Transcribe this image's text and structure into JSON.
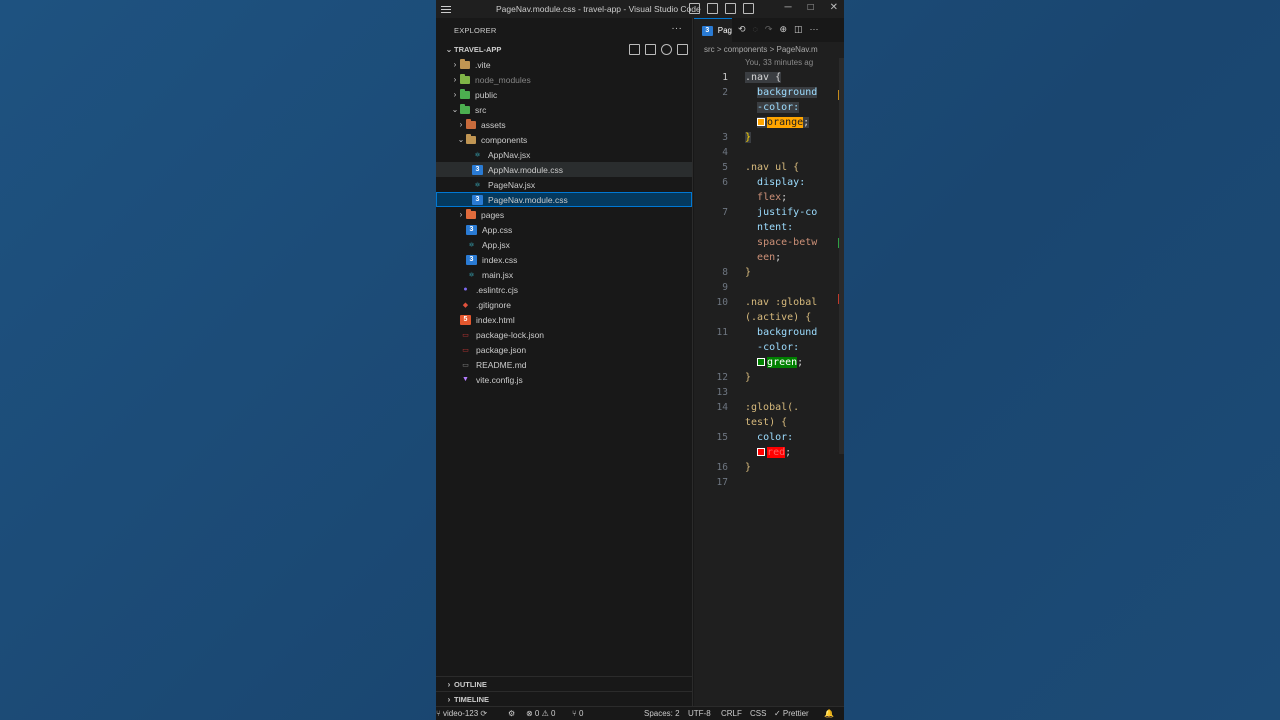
{
  "window": {
    "title": "PageNav.module.css - travel-app - Visual Studio Code",
    "controls": {
      "minimize": "─",
      "maximize": "□",
      "close": "✕"
    }
  },
  "explorer": {
    "header": "EXPLORER",
    "more": "···",
    "root": "TRAVEL-APP",
    "tree": [
      {
        "name": ".vite",
        "type": "folder",
        "depth": 1,
        "expanded": false,
        "color": "#c09553",
        "dim": false
      },
      {
        "name": "node_modules",
        "type": "folder",
        "depth": 1,
        "expanded": false,
        "color": "#7fb447",
        "dim": true
      },
      {
        "name": "public",
        "type": "folder",
        "depth": 1,
        "expanded": false,
        "color": "#4caf50",
        "dim": false
      },
      {
        "name": "src",
        "type": "folder",
        "depth": 1,
        "expanded": true,
        "color": "#4caf50",
        "dim": false
      },
      {
        "name": "assets",
        "type": "folder",
        "depth": 2,
        "expanded": false,
        "color": "#c86b3c",
        "dim": false
      },
      {
        "name": "components",
        "type": "folder",
        "depth": 2,
        "expanded": true,
        "color": "#c09553",
        "dim": false
      },
      {
        "name": "AppNav.jsx",
        "type": "react",
        "depth": 3
      },
      {
        "name": "AppNav.module.css",
        "type": "css",
        "depth": 3,
        "hover": true
      },
      {
        "name": "PageNav.jsx",
        "type": "react",
        "depth": 3
      },
      {
        "name": "PageNav.module.css",
        "type": "css",
        "depth": 3,
        "selected": true
      },
      {
        "name": "pages",
        "type": "folder",
        "depth": 2,
        "expanded": false,
        "color": "#e06b3c",
        "dim": false
      },
      {
        "name": "App.css",
        "type": "css",
        "depth": 2
      },
      {
        "name": "App.jsx",
        "type": "react",
        "depth": 2
      },
      {
        "name": "index.css",
        "type": "css",
        "depth": 2
      },
      {
        "name": "main.jsx",
        "type": "react",
        "depth": 2
      },
      {
        "name": ".eslintrc.cjs",
        "type": "eslint",
        "depth": 1
      },
      {
        "name": ".gitignore",
        "type": "git",
        "depth": 1
      },
      {
        "name": "index.html",
        "type": "html",
        "depth": 1
      },
      {
        "name": "package-lock.json",
        "type": "npm",
        "depth": 1
      },
      {
        "name": "package.json",
        "type": "npm",
        "depth": 1
      },
      {
        "name": "README.md",
        "type": "md",
        "depth": 1
      },
      {
        "name": "vite.config.js",
        "type": "vite",
        "depth": 1
      }
    ],
    "outline": "OUTLINE",
    "timeline": "TIMELINE"
  },
  "editor": {
    "tab_label": "Pag",
    "breadcrumb": "src > components > PageNav.m",
    "blame": "You, 33 minutes ag",
    "lines": [
      {
        "n": "1",
        "html": "<span class='sel2'>.nav {</span>"
      },
      {
        "n": "2",
        "html": "  <span class='sel2 prop'>background</span>"
      },
      {
        "n": "",
        "html": "  <span class='sel2 prop'>-color:</span>"
      },
      {
        "n": "",
        "html": "  <span class='sel2'><span class='sw' style='background:#ffa500'></span><span style='background:#ffa500;color:#1f1f1f'>orange</span><span class='p'>;</span></span>"
      },
      {
        "n": "3",
        "html": "<span class='sel2 br'>}</span>"
      },
      {
        "n": "4",
        "html": ""
      },
      {
        "n": "5",
        "html": "<span class='yel'>.nav ul {</span>"
      },
      {
        "n": "6",
        "html": "  <span class='prop'>display:</span>"
      },
      {
        "n": "",
        "html": "  <span class='val'>flex</span><span class='p'>;</span>"
      },
      {
        "n": "7",
        "html": "  <span class='prop'>justify-co</span>"
      },
      {
        "n": "",
        "html": "  <span class='prop'>ntent:</span>"
      },
      {
        "n": "",
        "html": "  <span class='val'>space-betw</span>"
      },
      {
        "n": "",
        "html": "  <span class='val'>een</span><span class='p'>;</span>"
      },
      {
        "n": "8",
        "html": "<span class='yel'>}</span>"
      },
      {
        "n": "9",
        "html": ""
      },
      {
        "n": "10",
        "html": "<span class='yel'>.nav :global</span>"
      },
      {
        "n": "",
        "html": "<span class='yel'>(.active) {</span>"
      },
      {
        "n": "11",
        "html": "  <span class='prop'>background</span>"
      },
      {
        "n": "",
        "html": "  <span class='prop'>-color:</span>"
      },
      {
        "n": "",
        "html": "  <span class='sw' style='background:#008000'></span><span style='background:#008000;color:#ffffff'>green</span><span class='p'>;</span>"
      },
      {
        "n": "12",
        "html": "<span class='yel'>}</span>"
      },
      {
        "n": "13",
        "html": ""
      },
      {
        "n": "14",
        "html": "<span class='yel'>:global(.</span>"
      },
      {
        "n": "",
        "html": "<span class='yel'>test) {</span>"
      },
      {
        "n": "15",
        "html": "  <span class='prop'>color:</span>"
      },
      {
        "n": "",
        "html": "  <span class='sw' style='background:#ff0000'></span><span style='background:#ff0000;color:#ff6060'>red</span><span class='p'>;</span>"
      },
      {
        "n": "16",
        "html": "<span class='yel'>}</span>"
      },
      {
        "n": "17",
        "html": ""
      }
    ]
  },
  "status": {
    "branch": "video-123",
    "problems": "⊗ 0 ⚠ 0",
    "ports": "⑂ 0",
    "spaces": "Spaces: 2",
    "encoding": "UTF-8",
    "eol": "CRLF",
    "lang": "CSS",
    "prettier": "✓ Prettier"
  },
  "colors": {
    "accent": "#0078d4",
    "selection": "#04395e",
    "background": "#1b4a73"
  }
}
